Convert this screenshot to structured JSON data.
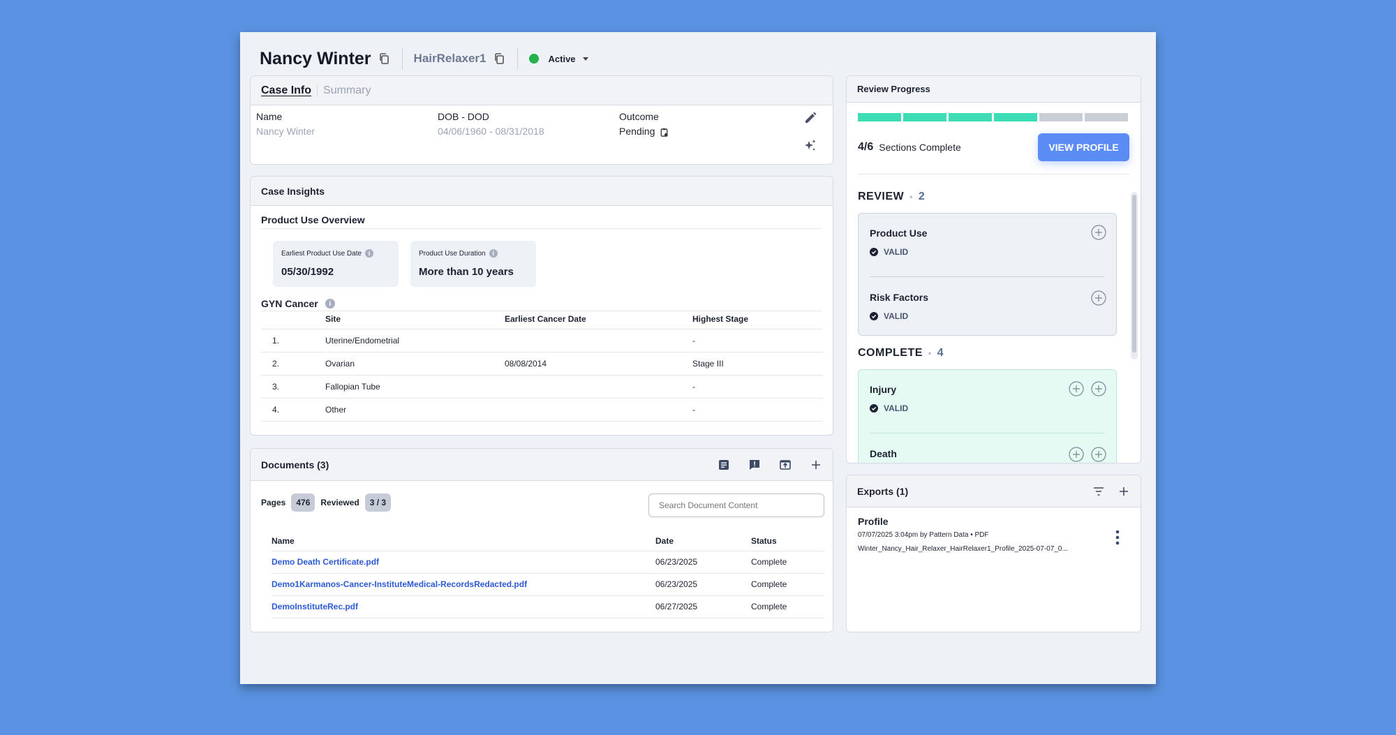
{
  "header": {
    "name": "Nancy Winter",
    "case_code": "HairRelaxer1",
    "status": "Active",
    "status_color": "#23b24b"
  },
  "case_info": {
    "tabs": [
      "Case Info",
      "Summary"
    ],
    "fields": [
      {
        "label": "Name",
        "value": "Nancy Winter"
      },
      {
        "label": "DOB - DOD",
        "value": "04/06/1960 - 08/31/2018"
      },
      {
        "label": "Outcome",
        "value": "Pending"
      }
    ]
  },
  "insights": {
    "title": "Case Insights",
    "product_overview": {
      "title": "Product Use Overview",
      "earliest_label": "Earliest Product Use Date",
      "earliest_value": "05/30/1992",
      "duration_label": "Product Use Duration",
      "duration_value": "More than 10 years"
    },
    "gyn": {
      "title": "GYN Cancer",
      "columns": [
        "Site",
        "Earliest Cancer Date",
        "Highest Stage"
      ],
      "rows": [
        {
          "idx": "1.",
          "site": "Uterine/Endometrial",
          "date": "",
          "stage": "-"
        },
        {
          "idx": "2.",
          "site": "Ovarian",
          "date": "08/08/2014",
          "stage": "Stage III"
        },
        {
          "idx": "3.",
          "site": "Fallopian Tube",
          "date": "",
          "stage": "-"
        },
        {
          "idx": "4.",
          "site": "Other",
          "date": "",
          "stage": "-"
        }
      ]
    }
  },
  "documents": {
    "title": "Documents (3)",
    "pages_label": "Pages",
    "pages_value": "476",
    "reviewed_label": "Reviewed",
    "reviewed_value": "3 / 3",
    "search_placeholder": "Search Document Content",
    "columns": [
      "Name",
      "Date",
      "Status"
    ],
    "rows": [
      {
        "name": "Demo Death Certificate.pdf",
        "date": "06/23/2025",
        "status": "Complete"
      },
      {
        "name": "Demo1Karmanos-Cancer-InstituteMedical-RecordsRedacted.pdf",
        "date": "06/23/2025",
        "status": "Complete"
      },
      {
        "name": "DemoInstituteRec.pdf",
        "date": "06/27/2025",
        "status": "Complete"
      }
    ]
  },
  "review": {
    "title": "Review Progress",
    "progress_completed": 4,
    "progress_total": 6,
    "progress_done_color": "#3ddbb6",
    "progress_todo_color": "#c8cdd6",
    "sections_count": "4/6",
    "sections_label": "Sections Complete",
    "view_profile": "VIEW PROFILE",
    "review_group": {
      "label": "REVIEW",
      "count": "2"
    },
    "complete_group": {
      "label": "COMPLETE",
      "count": "4"
    },
    "review_items": [
      {
        "title": "Product Use",
        "status": "VALID"
      },
      {
        "title": "Risk Factors",
        "status": "VALID"
      }
    ],
    "complete_items": [
      {
        "title": "Injury",
        "status": "VALID"
      },
      {
        "title": "Death",
        "status": ""
      }
    ]
  },
  "exports": {
    "title": "Exports (1)",
    "item_title": "Profile",
    "item_meta": "07/07/2025 3:04pm by Pattern Data • PDF",
    "item_file": "Winter_Nancy_Hair_Relaxer_HairRelaxer1_Profile_2025-07-07_0..."
  }
}
